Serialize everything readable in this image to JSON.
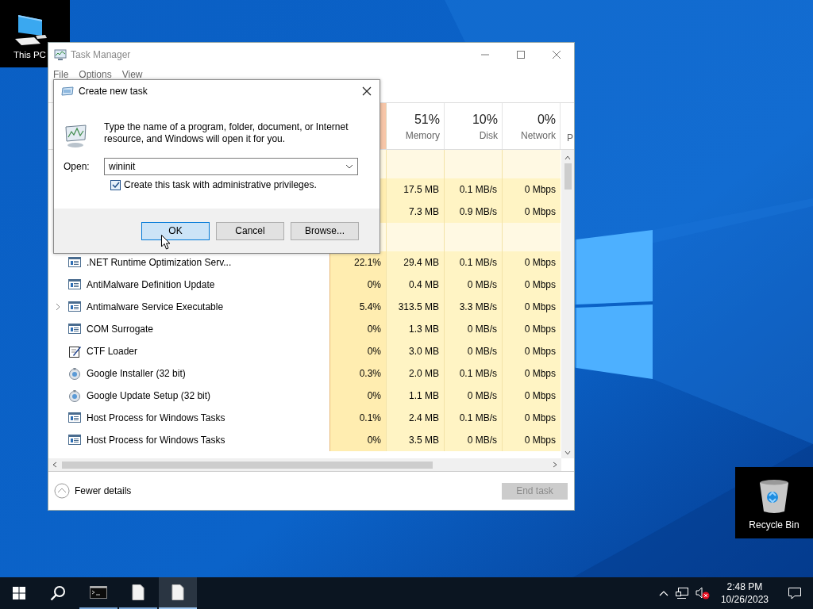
{
  "desktop_icons": [
    {
      "kind": "computer",
      "label": "This PC"
    },
    {
      "kind": "recycle",
      "label": "Recycle Bin"
    }
  ],
  "task_manager": {
    "title": "Task Manager",
    "menu": [
      "File",
      "Options",
      "View"
    ],
    "columns": [
      {
        "percent": "51%",
        "label": "Memory"
      },
      {
        "percent": "10%",
        "label": "Disk"
      },
      {
        "percent": "0%",
        "label": "Network"
      },
      {
        "label": "P"
      }
    ],
    "rows": [
      {
        "kind": "group"
      },
      {
        "kind": "hidden",
        "memory": "17.5 MB",
        "disk": "0.1 MB/s",
        "network": "0 Mbps"
      },
      {
        "kind": "hidden",
        "memory": "7.3 MB",
        "disk": "0.9 MB/s",
        "network": "0 Mbps"
      },
      {
        "kind": "group"
      },
      {
        "kind": "app",
        "name": ".NET Runtime Optimization Serv...",
        "cpu": "22.1%",
        "memory": "29.4 MB",
        "disk": "0.1 MB/s",
        "network": "0 Mbps"
      },
      {
        "kind": "app",
        "name": "AntiMalware Definition Update",
        "cpu": "0%",
        "memory": "0.4 MB",
        "disk": "0 MB/s",
        "network": "0 Mbps"
      },
      {
        "kind": "app",
        "expandable": true,
        "name": "Antimalware Service Executable",
        "cpu": "5.4%",
        "memory": "313.5 MB",
        "disk": "3.3 MB/s",
        "network": "0 Mbps"
      },
      {
        "kind": "app",
        "name": "COM Surrogate",
        "cpu": "0%",
        "memory": "1.3 MB",
        "disk": "0 MB/s",
        "network": "0 Mbps"
      },
      {
        "kind": "notepad",
        "name": "CTF Loader",
        "cpu": "0%",
        "memory": "3.0 MB",
        "disk": "0 MB/s",
        "network": "0 Mbps"
      },
      {
        "kind": "installer",
        "name": "Google Installer (32 bit)",
        "cpu": "0.3%",
        "memory": "2.0 MB",
        "disk": "0.1 MB/s",
        "network": "0 Mbps"
      },
      {
        "kind": "installer",
        "name": "Google Update Setup (32 bit)",
        "cpu": "0%",
        "memory": "1.1 MB",
        "disk": "0 MB/s",
        "network": "0 Mbps"
      },
      {
        "kind": "app",
        "name": "Host Process for Windows Tasks",
        "cpu": "0.1%",
        "memory": "2.4 MB",
        "disk": "0.1 MB/s",
        "network": "0 Mbps"
      },
      {
        "kind": "app",
        "name": "Host Process for Windows Tasks",
        "cpu": "0%",
        "memory": "3.5 MB",
        "disk": "0 MB/s",
        "network": "0 Mbps"
      }
    ],
    "fewer_details": "Fewer details",
    "end_task": {
      "label": "End task",
      "disabled": true
    }
  },
  "dialog": {
    "title": "Create new task",
    "message": "Type the name of a program, folder, document, or Internet resource, and Windows will open it for you.",
    "open_label": "Open:",
    "open_value": "wininit",
    "admin": {
      "label": "Create this task with administrative privileges.",
      "checked": true
    },
    "buttons": [
      {
        "label": "OK",
        "default": true
      },
      {
        "label": "Cancel",
        "default": false
      },
      {
        "label": "Browse...",
        "default": false
      }
    ]
  },
  "taskbar": {
    "apps": [
      {
        "kind": "console",
        "active": false
      },
      {
        "kind": "document",
        "active": false
      },
      {
        "kind": "document",
        "active": true
      }
    ],
    "volume_muted": true,
    "time": "2:48 PM",
    "date": "10/26/2023"
  }
}
